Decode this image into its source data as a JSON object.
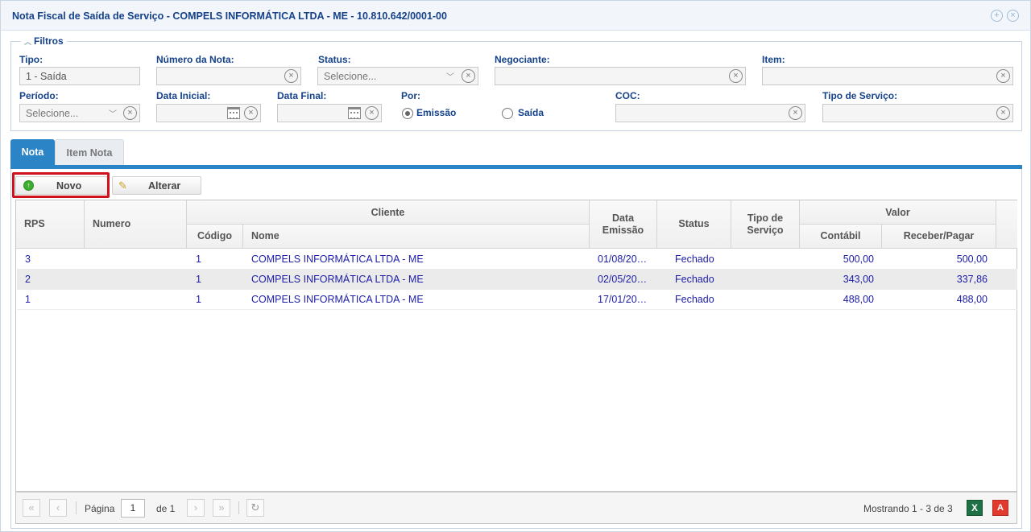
{
  "window": {
    "title": "Nota Fiscal de Saída de Serviço - COMPELS INFORMÁTICA LTDA - ME - 10.810.642/0001-00"
  },
  "filters": {
    "legend": "Filtros",
    "tipo": {
      "label": "Tipo:",
      "value": "1 - Saída"
    },
    "numero_nota": {
      "label": "Número da Nota:",
      "value": ""
    },
    "status": {
      "label": "Status:",
      "placeholder": "Selecione..."
    },
    "negociante": {
      "label": "Negociante:",
      "value": ""
    },
    "item": {
      "label": "Item:",
      "value": ""
    },
    "periodo": {
      "label": "Período:",
      "placeholder": "Selecione..."
    },
    "data_inicial": {
      "label": "Data Inicial:",
      "value": ""
    },
    "data_final": {
      "label": "Data Final:",
      "value": ""
    },
    "por": {
      "label": "Por:",
      "options": [
        "Emissão",
        "Saída"
      ],
      "selected": "Emissão"
    },
    "coc": {
      "label": "COC:",
      "value": ""
    },
    "tipo_servico": {
      "label": "Tipo de Serviço:",
      "value": ""
    }
  },
  "tabs": [
    {
      "label": "Nota",
      "active": true
    },
    {
      "label": "Item Nota",
      "active": false
    }
  ],
  "toolbar": {
    "novo_label": "Novo",
    "alterar_label": "Alterar"
  },
  "grid": {
    "headers": {
      "rps": "RPS",
      "numero": "Numero",
      "cliente": "Cliente",
      "codigo": "Código",
      "nome": "Nome",
      "data_emissao_1": "Data",
      "data_emissao_2": "Emissão",
      "status": "Status",
      "tipo_servico_1": "Tipo de",
      "tipo_servico_2": "Serviço",
      "valor": "Valor",
      "contabil": "Contábil",
      "receber_pagar": "Receber/Pagar"
    },
    "rows": [
      {
        "rps": "3",
        "numero": "",
        "codigo": "1",
        "nome": "COMPELS INFORMÁTICA LTDA - ME",
        "data": "01/08/20…",
        "status": "Fechado",
        "tipo": "",
        "contabil": "500,00",
        "receber": "500,00"
      },
      {
        "rps": "2",
        "numero": "",
        "codigo": "1",
        "nome": "COMPELS INFORMÁTICA LTDA - ME",
        "data": "02/05/20…",
        "status": "Fechado",
        "tipo": "",
        "contabil": "343,00",
        "receber": "337,86"
      },
      {
        "rps": "1",
        "numero": "",
        "codigo": "1",
        "nome": "COMPELS INFORMÁTICA LTDA - ME",
        "data": "17/01/20…",
        "status": "Fechado",
        "tipo": "",
        "contabil": "488,00",
        "receber": "488,00"
      }
    ]
  },
  "pager": {
    "page_label": "Página",
    "page_value": "1",
    "of_label": "de 1",
    "summary": "Mostrando 1 - 3 de 3",
    "xls_label": "X",
    "pdf_label": "A"
  },
  "colors": {
    "accent": "#2b84c6",
    "title": "#15428b",
    "highlight": "#d0121e",
    "row_text": "#1c1ca8"
  }
}
